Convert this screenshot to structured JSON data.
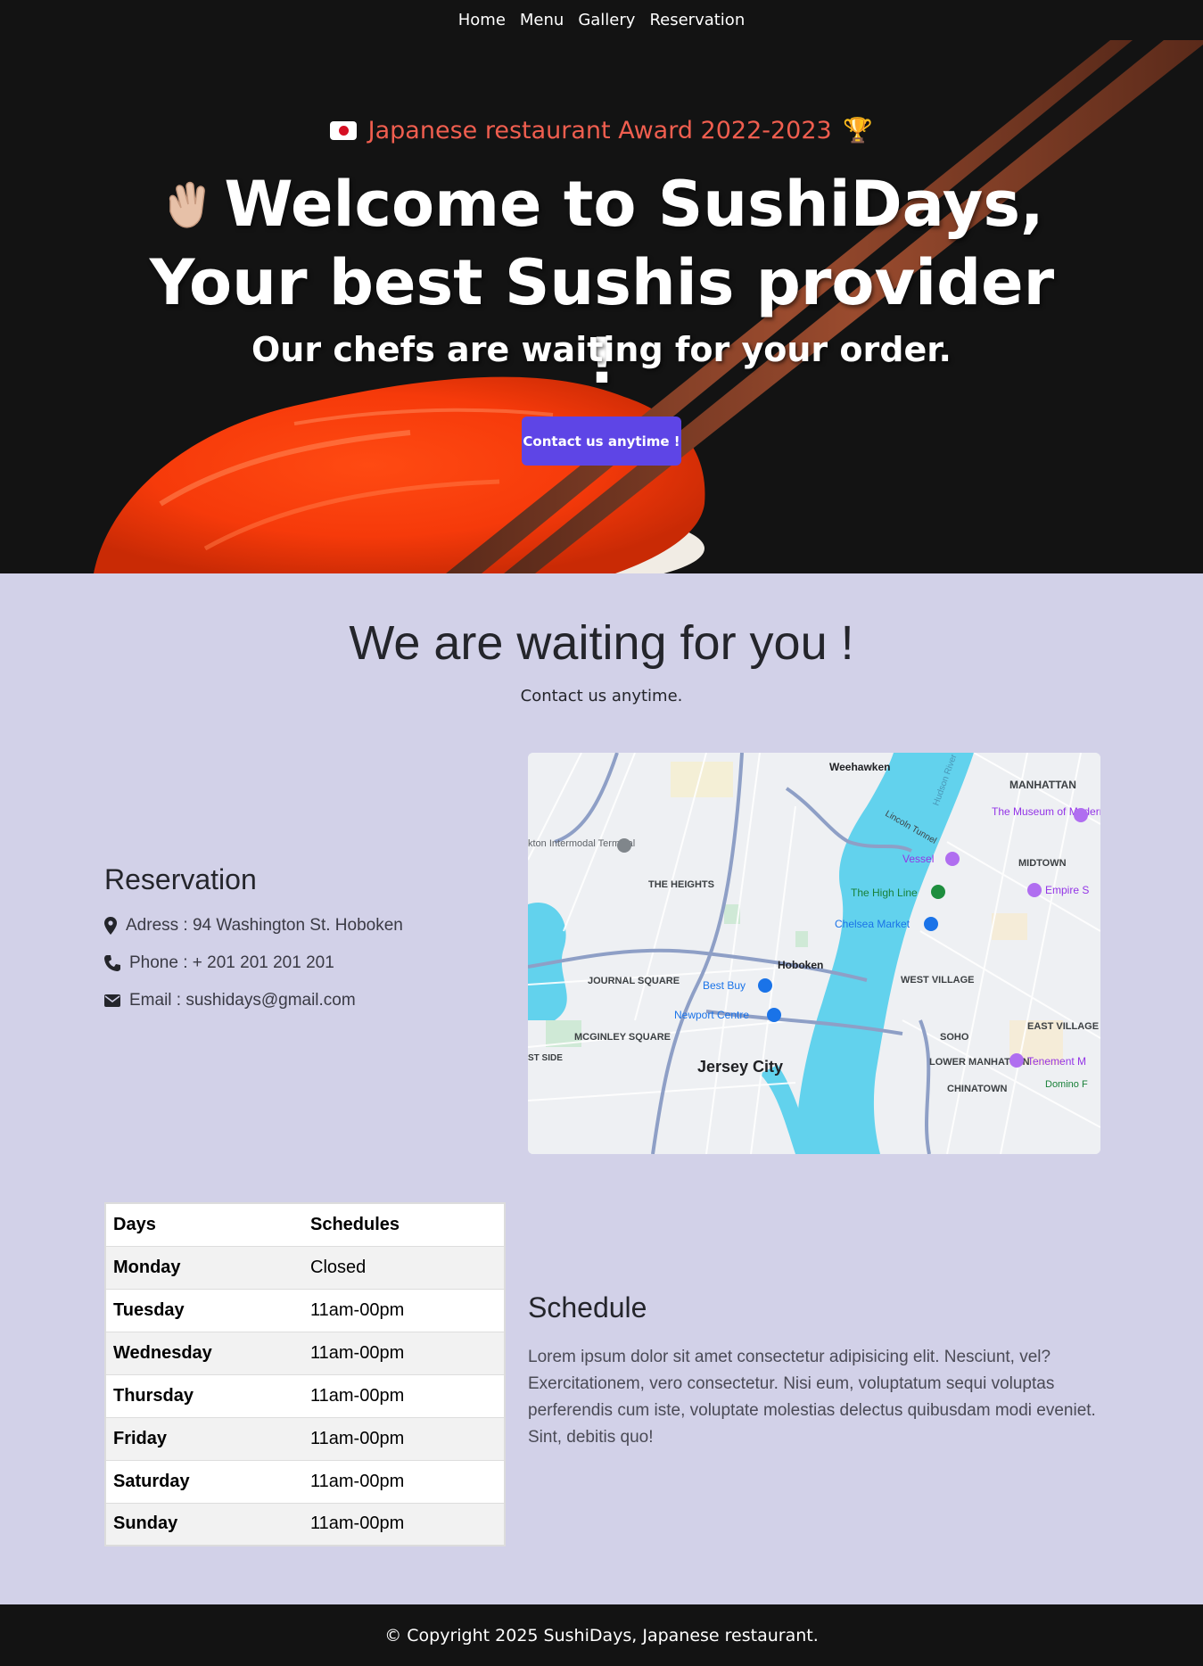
{
  "nav": {
    "items": [
      "Home",
      "Menu",
      "Gallery",
      "Reservation"
    ]
  },
  "hero": {
    "award": "Japanese restaurant Award 2022-2023",
    "title": "Welcome to SushiDays, Your best Sushis provider !",
    "subtitle": "Our chefs are waiting for your order.",
    "cta": "Contact us anytime !"
  },
  "contact": {
    "title": "We are waiting for you !",
    "subtitle": "Contact us anytime."
  },
  "reservation": {
    "heading": "Reservation",
    "address": "Adress : 94 Washington St. Hoboken",
    "phone": "Phone : + 201 201 201 201",
    "email": "Email : sushidays@gmail.com"
  },
  "map": {
    "labels": {
      "weehawken": "Weehawken",
      "manhattan": "MANHATTAN",
      "moma": "The Museum of Modern Art",
      "vessel": "Vessel",
      "midtown": "MIDTOWN",
      "highline": "The High Line",
      "empire": "Empire S",
      "chelsea": "Chelsea Market",
      "heights": "THE HEIGHTS",
      "hoboken": "Hoboken",
      "journal": "JOURNAL SQUARE",
      "bestbuy": "Best Buy",
      "newport": "Newport Centre",
      "westvillage": "WEST VILLAGE",
      "eastvillage": "EAST VILLAGE",
      "soho": "SOHO",
      "lowermanhattan": "LOWER MANHATTAN",
      "mcginley": "MCGINLEY SQUARE",
      "jersey": "Jersey City",
      "chinatown": "CHINATOWN",
      "tenement": "Tenement M",
      "terminal": "kton Intermodal Terminal",
      "lincoln": "Lincoln Tunnel",
      "westside": "ST SIDE",
      "domino": "Domino F"
    }
  },
  "schedule_table": {
    "headers": [
      "Days",
      "Schedules"
    ],
    "rows": [
      {
        "day": "Monday",
        "hours": "Closed"
      },
      {
        "day": "Tuesday",
        "hours": "11am-00pm"
      },
      {
        "day": "Wednesday",
        "hours": "11am-00pm"
      },
      {
        "day": "Thursday",
        "hours": "11am-00pm"
      },
      {
        "day": "Friday",
        "hours": "11am-00pm"
      },
      {
        "day": "Saturday",
        "hours": "11am-00pm"
      },
      {
        "day": "Sunday",
        "hours": "11am-00pm"
      }
    ]
  },
  "schedule": {
    "heading": "Schedule",
    "text": "Lorem ipsum dolor sit amet consectetur adipisicing elit. Nesciunt, vel? Exercitationem, vero consectetur. Nisi eum, voluptatum sequi voluptas perferendis cum iste, voluptate molestias delectus quibusdam modi eveniet. Sint, debitis quo!"
  },
  "footer": {
    "text": "© Copyright 2025 SushiDays, Japanese restaurant."
  },
  "colors": {
    "dark": "#131313",
    "accent": "#5e45e6",
    "award": "#f05e4f",
    "section_bg": "#d2d1e8"
  }
}
